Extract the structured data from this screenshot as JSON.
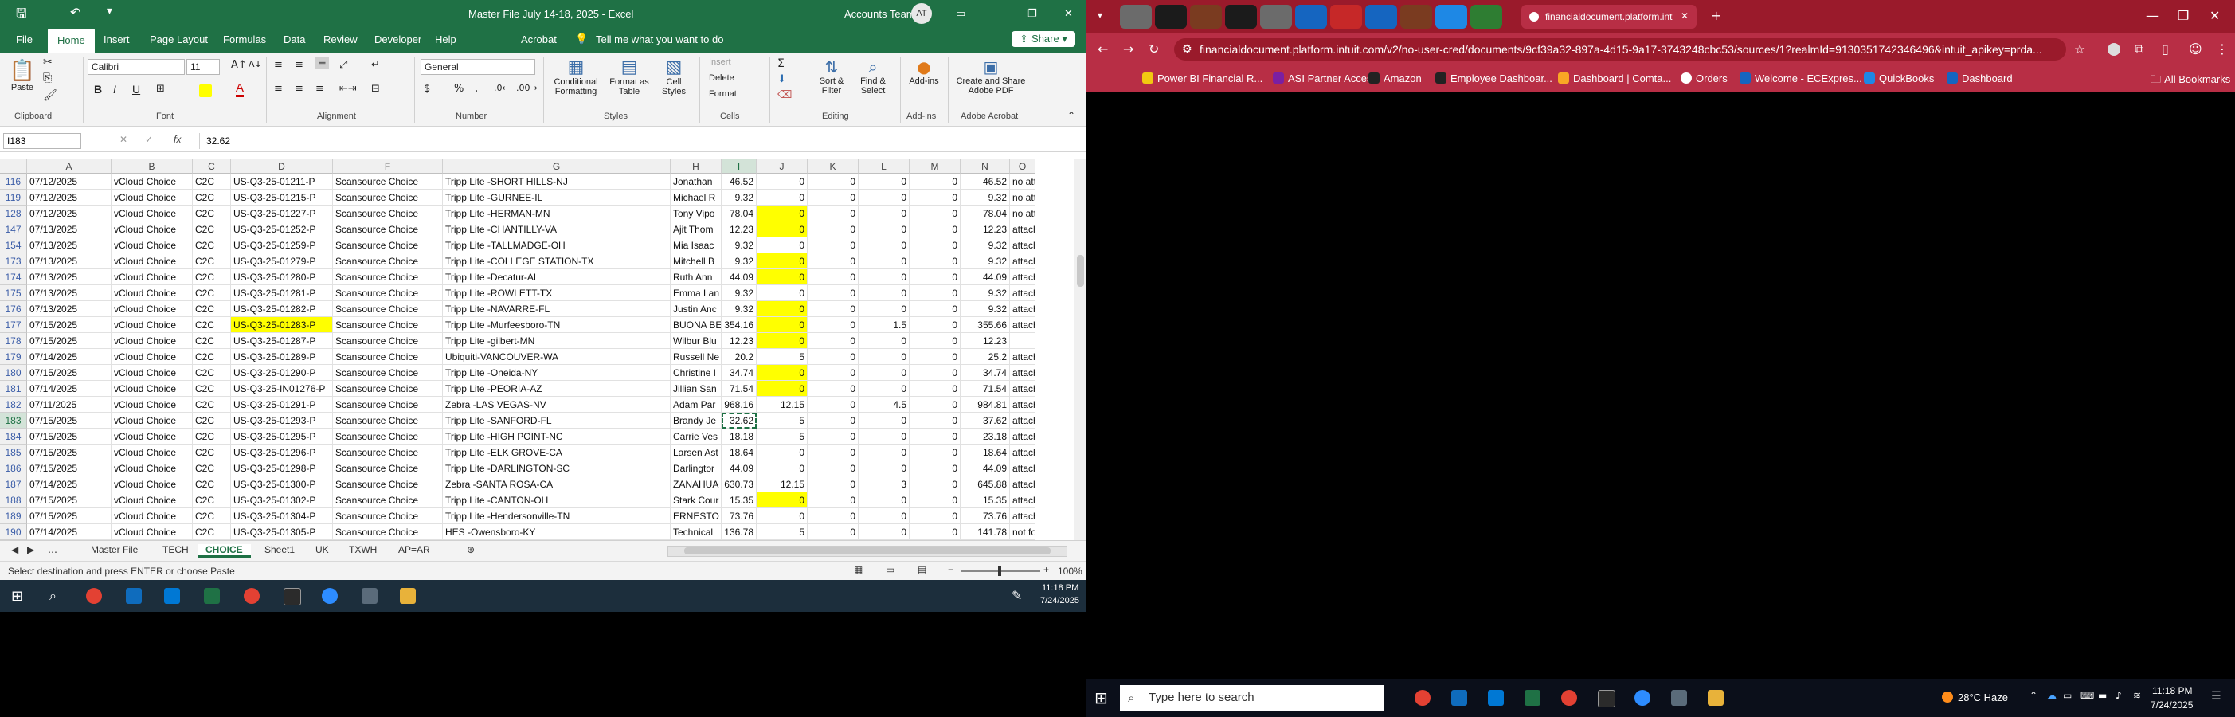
{
  "excel": {
    "quick_access": [
      "save-icon",
      "undo-icon",
      "redo-icon"
    ],
    "title": "Master File July 14-18, 2025  -  Excel",
    "account": "Accounts Team",
    "avatar": "AT",
    "tabs": [
      "File",
      "Home",
      "Insert",
      "Page Layout",
      "Formulas",
      "Data",
      "Review",
      "Developer",
      "Help",
      "Acrobat"
    ],
    "active_tab": "Home",
    "tell_me": "Tell me what you want to do",
    "share": "Share",
    "ribbon": {
      "paste": "Paste",
      "clipboard": "Clipboard",
      "font_name": "Calibri",
      "font_size": "11",
      "font": "Font",
      "alignment": "Alignment",
      "number_format": "General",
      "number": "Number",
      "conditional_formatting": "Conditional Formatting",
      "format_as_table": "Format as Table",
      "cell_styles": "Cell Styles",
      "styles": "Styles",
      "insert": "Insert",
      "delete": "Delete",
      "format": "Format",
      "cells": "Cells",
      "sort_filter": "Sort & Filter",
      "find_select": "Find & Select",
      "editing": "Editing",
      "addins": "Add-ins",
      "addins_group": "Add-ins",
      "create_share": "Create and Share Adobe PDF",
      "adobe_acrobat": "Adobe Acrobat",
      "bold": "B",
      "italic": "I",
      "underline": "U"
    },
    "name_box": "I183",
    "formula_value": "32.62",
    "columns": [
      "A",
      "B",
      "C",
      "D",
      "F",
      "G",
      "H",
      "I",
      "J",
      "K",
      "L",
      "M",
      "N",
      "O"
    ],
    "rows": [
      [
        "116",
        "07/12/2025",
        "vCloud Choice",
        "C2C",
        "US-Q3-25-01211-P",
        "Scansource Choice",
        "Tripp Lite -SHORT HILLS-NJ",
        "Jonathan",
        "46.52",
        "0",
        "0",
        "0",
        "0",
        "46.52",
        "no attachm"
      ],
      [
        "119",
        "07/12/2025",
        "vCloud Choice",
        "C2C",
        "US-Q3-25-01215-P",
        "Scansource Choice",
        "Tripp Lite -GURNEE-IL",
        "Michael R",
        "9.32",
        "0",
        "0",
        "0",
        "0",
        "9.32",
        "no attachm"
      ],
      [
        "128",
        "07/12/2025",
        "vCloud Choice",
        "C2C",
        "US-Q3-25-01227-P",
        "Scansource Choice",
        "Tripp Lite -HERMAN-MN",
        "Tony Vipo",
        "78.04",
        "0",
        "0",
        "0",
        "0",
        "78.04",
        "no attachm"
      ],
      [
        "147",
        "07/13/2025",
        "vCloud Choice",
        "C2C",
        "US-Q3-25-01252-P",
        "Scansource Choice",
        "Tripp Lite -CHANTILLY-VA",
        "Ajit Thom",
        "12.23",
        "0",
        "0",
        "0",
        "0",
        "12.23",
        "attachmen"
      ],
      [
        "154",
        "07/13/2025",
        "vCloud Choice",
        "C2C",
        "US-Q3-25-01259-P",
        "Scansource Choice",
        "Tripp Lite -TALLMADGE-OH",
        "Mia Isaac",
        "9.32",
        "0",
        "0",
        "0",
        "0",
        "9.32",
        "attachmen"
      ],
      [
        "173",
        "07/13/2025",
        "vCloud Choice",
        "C2C",
        "US-Q3-25-01279-P",
        "Scansource Choice",
        "Tripp Lite -COLLEGE STATION-TX",
        "Mitchell B",
        "9.32",
        "0",
        "0",
        "0",
        "0",
        "9.32",
        "attachmen"
      ],
      [
        "174",
        "07/13/2025",
        "vCloud Choice",
        "C2C",
        "US-Q3-25-01280-P",
        "Scansource Choice",
        "Tripp Lite -Decatur-AL",
        "Ruth Ann",
        "44.09",
        "0",
        "0",
        "0",
        "0",
        "44.09",
        "attachmen"
      ],
      [
        "175",
        "07/13/2025",
        "vCloud Choice",
        "C2C",
        "US-Q3-25-01281-P",
        "Scansource Choice",
        "Tripp Lite -ROWLETT-TX",
        "Emma Lan",
        "9.32",
        "0",
        "0",
        "0",
        "0",
        "9.32",
        "attachmen"
      ],
      [
        "176",
        "07/13/2025",
        "vCloud Choice",
        "C2C",
        "US-Q3-25-01282-P",
        "Scansource Choice",
        "Tripp Lite -NAVARRE-FL",
        "Justin Anc",
        "9.32",
        "0",
        "0",
        "0",
        "0",
        "9.32",
        "attachmen"
      ],
      [
        "177",
        "07/15/2025",
        "vCloud Choice",
        "C2C",
        "US-Q3-25-01283-P",
        "Scansource Choice",
        "Tripp Lite -Murfeesboro-TN",
        "BUONA BE",
        "354.16",
        "0",
        "0",
        "1.5",
        "0",
        "355.66",
        "attachmen"
      ],
      [
        "178",
        "07/15/2025",
        "vCloud Choice",
        "C2C",
        "US-Q3-25-01287-P",
        "Scansource Choice",
        "Tripp Lite -gilbert-MN",
        "Wilbur Blu",
        "12.23",
        "0",
        "0",
        "0",
        "0",
        "12.23",
        ""
      ],
      [
        "179",
        "07/14/2025",
        "vCloud Choice",
        "C2C",
        "US-Q3-25-01289-P",
        "Scansource Choice",
        "Ubiquiti-VANCOUVER-WA",
        "Russell Ne",
        "20.2",
        "5",
        "0",
        "0",
        "0",
        "25.2",
        "attachmen"
      ],
      [
        "180",
        "07/15/2025",
        "vCloud Choice",
        "C2C",
        "US-Q3-25-01290-P",
        "Scansource Choice",
        "Tripp Lite -Oneida-NY",
        "Christine I",
        "34.74",
        "0",
        "0",
        "0",
        "0",
        "34.74",
        "attachmen"
      ],
      [
        "181",
        "07/14/2025",
        "vCloud Choice",
        "C2C",
        "US-Q3-25-IN01276-P",
        "Scansource Choice",
        "Tripp Lite -PEORIA-AZ",
        "Jillian San",
        "71.54",
        "0",
        "0",
        "0",
        "0",
        "71.54",
        "attachmen"
      ],
      [
        "182",
        "07/11/2025",
        "vCloud Choice",
        "C2C",
        "US-Q3-25-01291-P",
        "Scansource Choice",
        "Zebra -LAS VEGAS-NV",
        "Adam Par",
        "968.16",
        "12.15",
        "0",
        "4.5",
        "0",
        "984.81",
        "attachmen"
      ],
      [
        "183",
        "07/15/2025",
        "vCloud Choice",
        "C2C",
        "US-Q3-25-01293-P",
        "Scansource Choice",
        "Tripp Lite -SANFORD-FL",
        "Brandy Je",
        "32.62",
        "5",
        "0",
        "0",
        "0",
        "37.62",
        "attachmen"
      ],
      [
        "184",
        "07/15/2025",
        "vCloud Choice",
        "C2C",
        "US-Q3-25-01295-P",
        "Scansource Choice",
        "Tripp Lite -HIGH POINT-NC",
        "Carrie Ves",
        "18.18",
        "5",
        "0",
        "0",
        "0",
        "23.18",
        "attachmen"
      ],
      [
        "185",
        "07/15/2025",
        "vCloud Choice",
        "C2C",
        "US-Q3-25-01296-P",
        "Scansource Choice",
        "Tripp Lite -ELK GROVE-CA",
        "Larsen Ast",
        "18.64",
        "0",
        "0",
        "0",
        "0",
        "18.64",
        "attachmen"
      ],
      [
        "186",
        "07/15/2025",
        "vCloud Choice",
        "C2C",
        "US-Q3-25-01298-P",
        "Scansource Choice",
        "Tripp Lite -DARLINGTON-SC",
        "Darlingtor",
        "44.09",
        "0",
        "0",
        "0",
        "0",
        "44.09",
        "attachmen"
      ],
      [
        "187",
        "07/14/2025",
        "vCloud Choice",
        "C2C",
        "US-Q3-25-01300-P",
        "Scansource Choice",
        "Zebra -SANTA ROSA-CA",
        "ZANAHUA",
        "630.73",
        "12.15",
        "0",
        "3",
        "0",
        "645.88",
        "attachmen"
      ],
      [
        "188",
        "07/15/2025",
        "vCloud Choice",
        "C2C",
        "US-Q3-25-01302-P",
        "Scansource Choice",
        "Tripp Lite -CANTON-OH",
        "Stark Cour",
        "15.35",
        "0",
        "0",
        "0",
        "0",
        "15.35",
        "attachmen"
      ],
      [
        "189",
        "07/15/2025",
        "vCloud Choice",
        "C2C",
        "US-Q3-25-01304-P",
        "Scansource Choice",
        "Tripp Lite -Hendersonville-TN",
        "ERNESTO",
        "73.76",
        "0",
        "0",
        "0",
        "0",
        "73.76",
        "attachmen"
      ],
      [
        "190",
        "07/14/2025",
        "vCloud Choice",
        "C2C",
        "US-Q3-25-01305-P",
        "Scansource Choice",
        "HES -Owensboro-KY",
        "Technical",
        "136.78",
        "5",
        "0",
        "0",
        "0",
        "141.78",
        "not found"
      ]
    ],
    "yellow_j_rows": [
      2,
      3,
      5,
      6,
      8,
      9,
      10,
      12,
      13,
      20
    ],
    "yellow_d_rows": [
      9
    ],
    "sheets": [
      "Master File",
      "TECH",
      "CHOICE",
      "Sheet1",
      "UK",
      "TXWH",
      "AP=AR"
    ],
    "active_sheet": "CHOICE",
    "status_text": "Select destination and press ENTER or choose Paste",
    "zoom": "100%",
    "time": "11:18 PM",
    "date": "7/24/2025",
    "colors": {
      "excel_green": "#1f7145",
      "highlight": "#ffff00"
    }
  },
  "chrome": {
    "active_tab_title": "financialdocument.platform.int",
    "url": "financialdocument.platform.intuit.com/v2/no-user-cred/documents/9cf39a32-897a-4d15-9a17-3743248cbc53/sources/1?realmId=9130351742346496&intuit_apikey=prda...",
    "bookmarks": [
      "Power BI Financial R...",
      "ASI Partner Access",
      "Amazon",
      "Employee Dashboar...",
      "Dashboard | Comta...",
      "Orders",
      "Welcome - ECExpres...",
      "QuickBooks",
      "Dashboard"
    ],
    "all_bookmarks": "All Bookmarks",
    "search_placeholder": "Type here to search",
    "weather": "28°C  Haze",
    "time": "11:18 PM",
    "date": "7/24/2025",
    "colors": {
      "tabbar": "#9a1a2b",
      "toolbar": "#b82e45"
    }
  }
}
